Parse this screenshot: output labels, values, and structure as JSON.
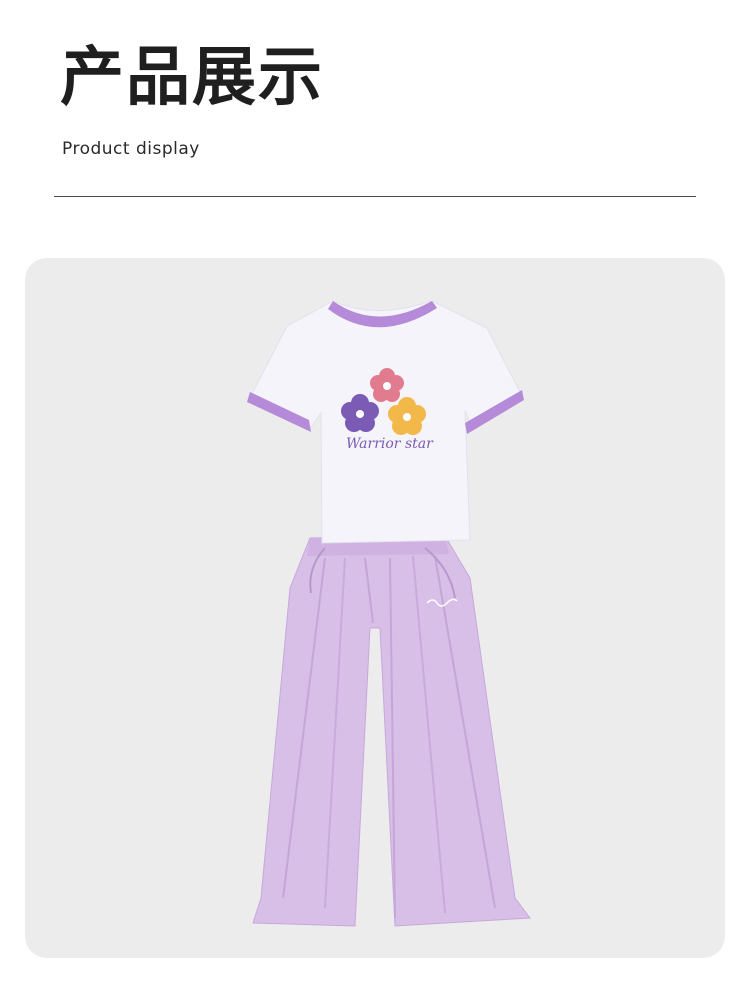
{
  "header": {
    "title_zh": "产品展示",
    "title_en": "Product display"
  },
  "product": {
    "tshirt_print_text": "Warrior star",
    "colors": {
      "tshirt": "#f6f4fb",
      "trim": "#b58ad9",
      "pants": "#d7bde6",
      "flower_purple": "#7b5bb4",
      "flower_pink": "#e07c8e",
      "flower_yellow": "#f2b94a"
    }
  }
}
